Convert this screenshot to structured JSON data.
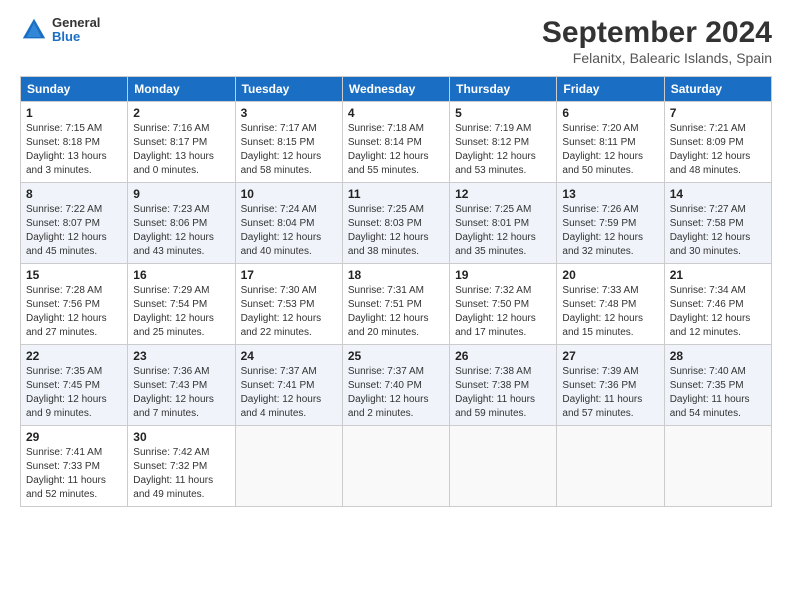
{
  "header": {
    "logo": {
      "general": "General",
      "blue": "Blue"
    },
    "title": "September 2024",
    "location": "Felanitx, Balearic Islands, Spain"
  },
  "weekdays": [
    "Sunday",
    "Monday",
    "Tuesday",
    "Wednesday",
    "Thursday",
    "Friday",
    "Saturday"
  ],
  "weeks": [
    [
      {
        "day": "1",
        "sunrise": "Sunrise: 7:15 AM",
        "sunset": "Sunset: 8:18 PM",
        "daylight": "Daylight: 13 hours and 3 minutes."
      },
      {
        "day": "2",
        "sunrise": "Sunrise: 7:16 AM",
        "sunset": "Sunset: 8:17 PM",
        "daylight": "Daylight: 13 hours and 0 minutes."
      },
      {
        "day": "3",
        "sunrise": "Sunrise: 7:17 AM",
        "sunset": "Sunset: 8:15 PM",
        "daylight": "Daylight: 12 hours and 58 minutes."
      },
      {
        "day": "4",
        "sunrise": "Sunrise: 7:18 AM",
        "sunset": "Sunset: 8:14 PM",
        "daylight": "Daylight: 12 hours and 55 minutes."
      },
      {
        "day": "5",
        "sunrise": "Sunrise: 7:19 AM",
        "sunset": "Sunset: 8:12 PM",
        "daylight": "Daylight: 12 hours and 53 minutes."
      },
      {
        "day": "6",
        "sunrise": "Sunrise: 7:20 AM",
        "sunset": "Sunset: 8:11 PM",
        "daylight": "Daylight: 12 hours and 50 minutes."
      },
      {
        "day": "7",
        "sunrise": "Sunrise: 7:21 AM",
        "sunset": "Sunset: 8:09 PM",
        "daylight": "Daylight: 12 hours and 48 minutes."
      }
    ],
    [
      {
        "day": "8",
        "sunrise": "Sunrise: 7:22 AM",
        "sunset": "Sunset: 8:07 PM",
        "daylight": "Daylight: 12 hours and 45 minutes."
      },
      {
        "day": "9",
        "sunrise": "Sunrise: 7:23 AM",
        "sunset": "Sunset: 8:06 PM",
        "daylight": "Daylight: 12 hours and 43 minutes."
      },
      {
        "day": "10",
        "sunrise": "Sunrise: 7:24 AM",
        "sunset": "Sunset: 8:04 PM",
        "daylight": "Daylight: 12 hours and 40 minutes."
      },
      {
        "day": "11",
        "sunrise": "Sunrise: 7:25 AM",
        "sunset": "Sunset: 8:03 PM",
        "daylight": "Daylight: 12 hours and 38 minutes."
      },
      {
        "day": "12",
        "sunrise": "Sunrise: 7:25 AM",
        "sunset": "Sunset: 8:01 PM",
        "daylight": "Daylight: 12 hours and 35 minutes."
      },
      {
        "day": "13",
        "sunrise": "Sunrise: 7:26 AM",
        "sunset": "Sunset: 7:59 PM",
        "daylight": "Daylight: 12 hours and 32 minutes."
      },
      {
        "day": "14",
        "sunrise": "Sunrise: 7:27 AM",
        "sunset": "Sunset: 7:58 PM",
        "daylight": "Daylight: 12 hours and 30 minutes."
      }
    ],
    [
      {
        "day": "15",
        "sunrise": "Sunrise: 7:28 AM",
        "sunset": "Sunset: 7:56 PM",
        "daylight": "Daylight: 12 hours and 27 minutes."
      },
      {
        "day": "16",
        "sunrise": "Sunrise: 7:29 AM",
        "sunset": "Sunset: 7:54 PM",
        "daylight": "Daylight: 12 hours and 25 minutes."
      },
      {
        "day": "17",
        "sunrise": "Sunrise: 7:30 AM",
        "sunset": "Sunset: 7:53 PM",
        "daylight": "Daylight: 12 hours and 22 minutes."
      },
      {
        "day": "18",
        "sunrise": "Sunrise: 7:31 AM",
        "sunset": "Sunset: 7:51 PM",
        "daylight": "Daylight: 12 hours and 20 minutes."
      },
      {
        "day": "19",
        "sunrise": "Sunrise: 7:32 AM",
        "sunset": "Sunset: 7:50 PM",
        "daylight": "Daylight: 12 hours and 17 minutes."
      },
      {
        "day": "20",
        "sunrise": "Sunrise: 7:33 AM",
        "sunset": "Sunset: 7:48 PM",
        "daylight": "Daylight: 12 hours and 15 minutes."
      },
      {
        "day": "21",
        "sunrise": "Sunrise: 7:34 AM",
        "sunset": "Sunset: 7:46 PM",
        "daylight": "Daylight: 12 hours and 12 minutes."
      }
    ],
    [
      {
        "day": "22",
        "sunrise": "Sunrise: 7:35 AM",
        "sunset": "Sunset: 7:45 PM",
        "daylight": "Daylight: 12 hours and 9 minutes."
      },
      {
        "day": "23",
        "sunrise": "Sunrise: 7:36 AM",
        "sunset": "Sunset: 7:43 PM",
        "daylight": "Daylight: 12 hours and 7 minutes."
      },
      {
        "day": "24",
        "sunrise": "Sunrise: 7:37 AM",
        "sunset": "Sunset: 7:41 PM",
        "daylight": "Daylight: 12 hours and 4 minutes."
      },
      {
        "day": "25",
        "sunrise": "Sunrise: 7:37 AM",
        "sunset": "Sunset: 7:40 PM",
        "daylight": "Daylight: 12 hours and 2 minutes."
      },
      {
        "day": "26",
        "sunrise": "Sunrise: 7:38 AM",
        "sunset": "Sunset: 7:38 PM",
        "daylight": "Daylight: 11 hours and 59 minutes."
      },
      {
        "day": "27",
        "sunrise": "Sunrise: 7:39 AM",
        "sunset": "Sunset: 7:36 PM",
        "daylight": "Daylight: 11 hours and 57 minutes."
      },
      {
        "day": "28",
        "sunrise": "Sunrise: 7:40 AM",
        "sunset": "Sunset: 7:35 PM",
        "daylight": "Daylight: 11 hours and 54 minutes."
      }
    ],
    [
      {
        "day": "29",
        "sunrise": "Sunrise: 7:41 AM",
        "sunset": "Sunset: 7:33 PM",
        "daylight": "Daylight: 11 hours and 52 minutes."
      },
      {
        "day": "30",
        "sunrise": "Sunrise: 7:42 AM",
        "sunset": "Sunset: 7:32 PM",
        "daylight": "Daylight: 11 hours and 49 minutes."
      },
      null,
      null,
      null,
      null,
      null
    ]
  ]
}
